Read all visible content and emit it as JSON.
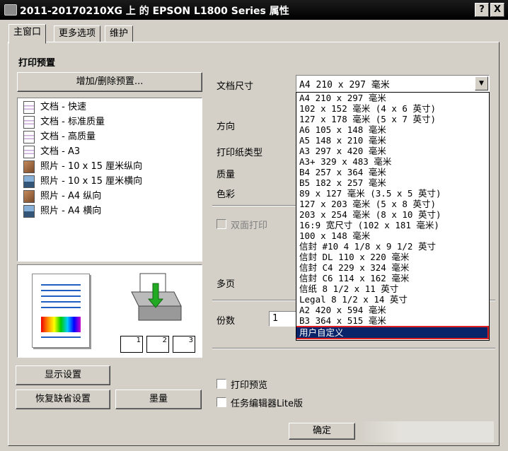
{
  "window": {
    "title": "2011-20170210XG 上 的 EPSON L1800 Series 属性",
    "help_label": "?",
    "close_label": "X"
  },
  "tabs": [
    {
      "label": "主窗口"
    },
    {
      "label": "更多选项"
    },
    {
      "label": "维护"
    }
  ],
  "presets": {
    "heading": "打印预置",
    "add_remove_label": "增加/删除预置...",
    "items": [
      {
        "label": "文档 - 快速",
        "icon": "document-icon"
      },
      {
        "label": "文档 - 标准质量",
        "icon": "document-icon"
      },
      {
        "label": "文档 - 高质量",
        "icon": "document-icon"
      },
      {
        "label": "文档 - A3",
        "icon": "document-icon"
      },
      {
        "label": "照片 - 10 x 15 厘米纵向",
        "icon": "photo-portrait-icon"
      },
      {
        "label": "照片 - 10 x 15 厘米横向",
        "icon": "photo-landscape-icon"
      },
      {
        "label": "照片 - A4 纵向",
        "icon": "photo-portrait-icon"
      },
      {
        "label": "照片 - A4 横向",
        "icon": "photo-landscape-icon"
      }
    ]
  },
  "preview": {
    "copy_icons": [
      "1",
      "2",
      "3"
    ]
  },
  "settings": {
    "doc_size_label": "文档尺寸",
    "doc_size_value": "A4 210 x 297 毫米",
    "orientation_label": "方向",
    "paper_type_label": "打印纸类型",
    "quality_label": "质量",
    "color_label": "色彩",
    "duplex_label": "双面打印",
    "multipage_label": "多页",
    "copies_label": "份数",
    "copies_value": "1"
  },
  "size_options": [
    "A4 210 x 297 毫米",
    "102 x 152 毫米 (4 x 6 英寸)",
    "127 x 178 毫米 (5 x 7 英寸)",
    "A6 105 x 148 毫米",
    "A5 148 x 210 毫米",
    "A3 297 x 420 毫米",
    "A3+ 329 x 483 毫米",
    "B4 257 x 364 毫米",
    "B5 182 x 257 毫米",
    "89 x 127 毫米 (3.5 x 5 英寸)",
    "127 x 203 毫米 (5 x 8 英寸)",
    "203 x 254 毫米 (8 x 10 英寸)",
    "16:9 宽尺寸 (102 x 181 毫米)",
    "100 x 148 毫米",
    "信封 #10 4 1/8 x 9 1/2 英寸",
    "信封 DL  110 x 220 毫米",
    "信封 C4  229 x 324 毫米",
    "信封 C6  114 x 162 毫米",
    "信纸 8 1/2 x 11 英寸",
    "Legal 8 1/2 x 14 英寸",
    "A2 420 x 594 毫米",
    "B3 364 x 515 毫米",
    "用户自定义"
  ],
  "selected_option_index": 22,
  "bottom": {
    "show_settings_label": "显示设置",
    "restore_defaults_label": "恢复缺省设置",
    "ink_levels_label": "墨量",
    "print_preview_label": "打印预览",
    "job_arranger_label": "任务编辑器Lite版",
    "ok_label": "确定"
  },
  "colors": {
    "title_bar": "#000000",
    "selection": "#0a246a",
    "highlight_border": "#e02020",
    "face": "#d4d0c8"
  }
}
